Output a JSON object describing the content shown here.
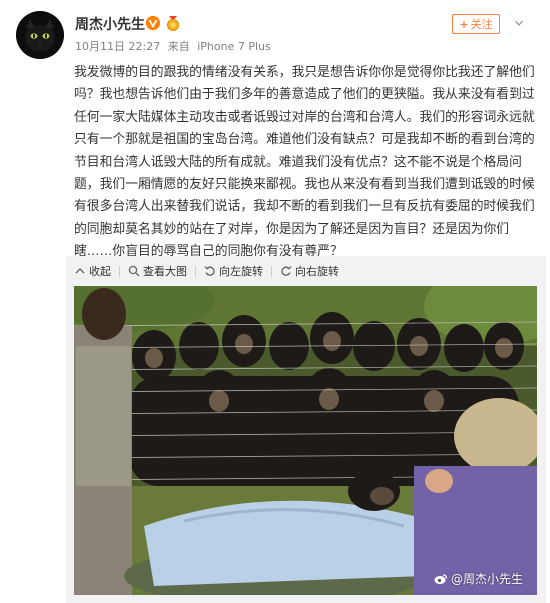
{
  "post": {
    "author": "周杰小先生",
    "date": "10月11日 22:27",
    "source_prefix": "来自",
    "source": "iPhone 7 Plus",
    "follow_label": "关注",
    "text": "我发微博的目的跟我的情绪没有关系，我只是想告诉你你是觉得你比我还了解他们吗？我也想告诉他们由于我们多年的善意造成了他们的更狭隘。我从来没有看到过任何一家大陆媒体主动攻击或者诋毁过对岸的台湾和台湾人。我们的形容词永远就只有一个那就是祖国的宝岛台湾。难道他们没有缺点？可是我却不断的看到台湾的节目和台湾人诋毁大陆的所有成就。难道我们没有优点？这不能不说是个格局问题，我们一厢情愿的友好只能换来鄙视。我也从来没有看到当我们遭到诋毁的时候有很多台湾人出来替我们说话，我却不断的看到我们一旦有反抗有委屈的时候我们的同胞却莫名其妙的站在了对岸，你是因为了解还是因为盲目？还是因为你们瞎……你盲目的辱骂自己的同胞你有没有尊严？"
  },
  "toolbar": {
    "collapse": "收起",
    "view_large": "查看大图",
    "rotate_left": "向左旋转",
    "rotate_right": "向右旋转"
  },
  "image": {
    "watermark": "@周杰小先生"
  },
  "colors": {
    "accent": "#ff8140",
    "badge": "#ff8200",
    "panel_bg": "#f2f2f5"
  }
}
